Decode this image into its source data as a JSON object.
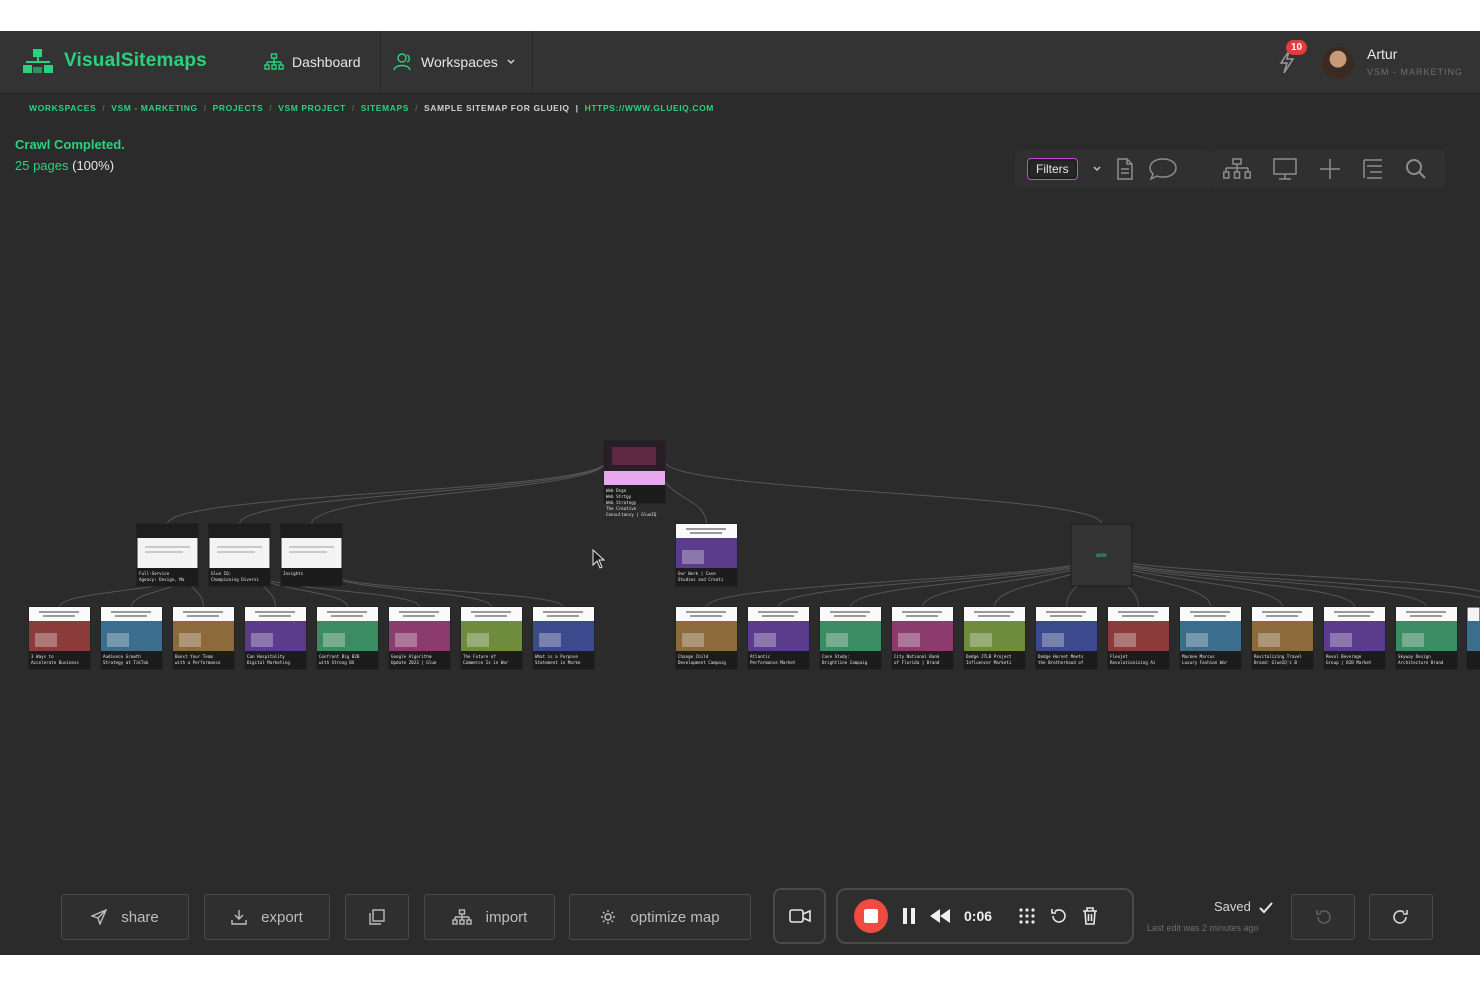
{
  "app": {
    "name": "VisualSitemaps",
    "brand_color": "#2bd17e",
    "background": "#2b2b2b"
  },
  "nav": {
    "dashboard": "Dashboard",
    "workspaces": "Workspaces"
  },
  "user": {
    "name": "Artur",
    "role": "VSM - MARKETING",
    "notification_count": "10"
  },
  "breadcrumb": [
    "WORKSPACES",
    "VSM - MARKETING",
    "PROJECTS",
    "VSM PROJECT",
    "SITEMAPS",
    "SAMPLE SITEMAP FOR GLUEIQ",
    "HTTPS://WWW.GLUEIQ.COM"
  ],
  "crawl": {
    "status": "Crawl Completed.",
    "pages": "25 pages",
    "percent": "(100%)"
  },
  "toolbar": {
    "filters_label": "Filters"
  },
  "sitemap": {
    "root": {
      "label": [
        "Web Dsgn",
        "Web Strtgy",
        "Web Strategy",
        "The Creative",
        "Consultancy | GlueIQ"
      ]
    },
    "left_branches": [
      {
        "label": [
          "Full-Service",
          "Agency: Design, Ma"
        ]
      },
      {
        "label": [
          "Glue IQ:",
          "Championing Diversi"
        ]
      },
      {
        "label": [
          "Insights"
        ]
      }
    ],
    "middle_branch": {
      "label": [
        "Our Work | Case",
        "Studies and Creati"
      ]
    },
    "right_branch": {
      "label": [
        "WORK"
      ]
    },
    "left_leaves": [
      {
        "label": [
          "3 Ways to",
          "Accelerate Business"
        ]
      },
      {
        "label": [
          "Audience Growth",
          "Strategy at TikTok"
        ]
      },
      {
        "label": [
          "Boost Your Team",
          "with a Performance"
        ]
      },
      {
        "label": [
          "Can Hospitality",
          "Digital Marketing"
        ]
      },
      {
        "label": [
          "Confront Big B2B",
          "with Strong BX"
        ]
      },
      {
        "label": [
          "Google Algorithm",
          "Update 2023 | Glue"
        ]
      },
      {
        "label": [
          "The Future of",
          "Commerce Is in Wor"
        ]
      },
      {
        "label": [
          "What is a Purpose",
          "Statement in Marke"
        ]
      }
    ],
    "right_leaves": [
      {
        "label": [
          "Change Child",
          "Development Campaig"
        ]
      },
      {
        "label": [
          "Atlantic",
          "Performance Market"
        ]
      },
      {
        "label": [
          "Case Study:",
          "Brightline Campaig"
        ]
      },
      {
        "label": [
          "City National Bank",
          "of Florida | Brand"
        ]
      },
      {
        "label": [
          "Dodge JTLB Project",
          "Influencer Marketi"
        ]
      },
      {
        "label": [
          "Dodge Hornet Meets",
          "the Brotherhood of"
        ]
      },
      {
        "label": [
          "Flexjet",
          "Revolutionizing Ai"
        ]
      },
      {
        "label": [
          "Mackee Marcus",
          "Luxury Fashion Wor"
        ]
      },
      {
        "label": [
          "Revitalizing Travel",
          "Brand: GlueIQ's B"
        ]
      },
      {
        "label": [
          "Revol Beverage",
          "Group | B2B Market"
        ]
      },
      {
        "label": [
          "Skyway Design",
          "Architecture Brand"
        ]
      }
    ]
  },
  "bottom": {
    "share": "share",
    "export": "export",
    "import": "import",
    "optimize": "optimize map",
    "timer": "0:06",
    "saved": "Saved",
    "last_edit": "Last edit was 2 minutes ago"
  }
}
